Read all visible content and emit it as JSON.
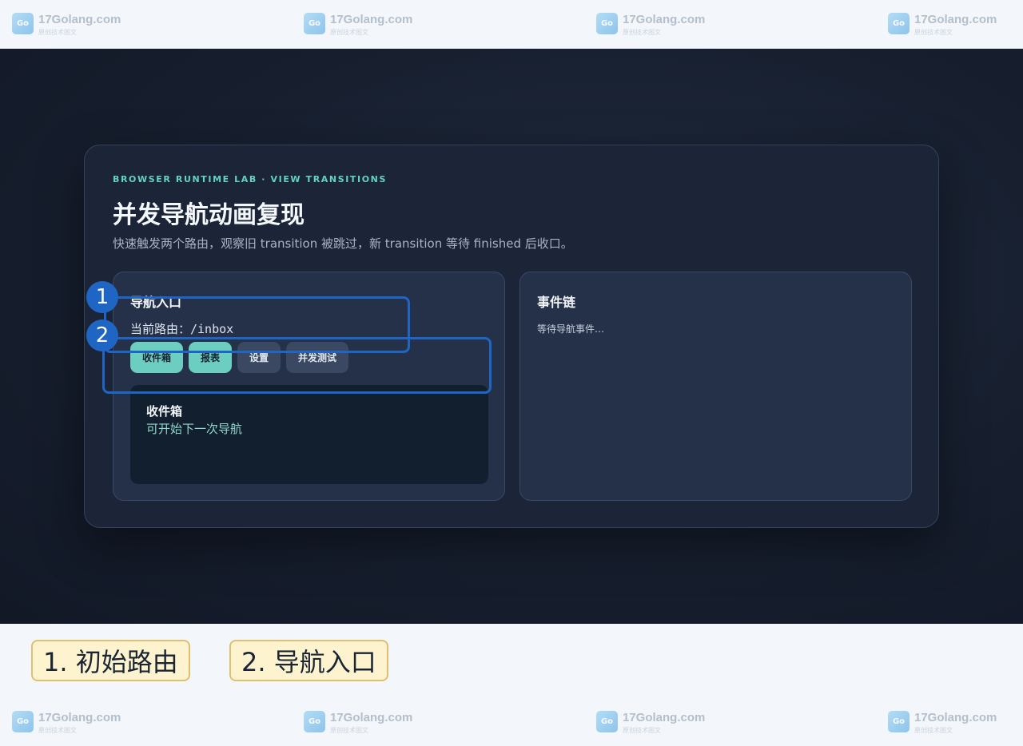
{
  "watermark": {
    "name": "17Golang.com",
    "sub": "原创技术图文"
  },
  "header": {
    "eyebrow": "BROWSER RUNTIME LAB · VIEW TRANSITIONS",
    "title": "并发导航动画复现",
    "subtitle": "快速触发两个路由，观察旧 transition 被跳过，新 transition 等待 finished 后收口。"
  },
  "nav_panel": {
    "title": "导航入口",
    "route_label": "当前路由：/inbox",
    "buttons": [
      {
        "label": "收件箱",
        "state": "active"
      },
      {
        "label": "报表",
        "state": "active"
      },
      {
        "label": "设置",
        "state": "muted"
      },
      {
        "label": "并发测试",
        "state": "muted"
      }
    ],
    "view": {
      "title": "收件箱",
      "status": "可开始下一次导航"
    }
  },
  "events_panel": {
    "title": "事件链",
    "empty_text": "等待导航事件…"
  },
  "annotations": {
    "markers": [
      "1",
      "2"
    ],
    "legend": [
      "1. 初始路由",
      "2. 导航入口"
    ]
  },
  "colors": {
    "accent": "#63d2c0",
    "button_active": "#6ccdc1",
    "button_muted": "#3a4862",
    "annotation": "#1f66c4",
    "legend_bg": "#fdf3cf"
  }
}
